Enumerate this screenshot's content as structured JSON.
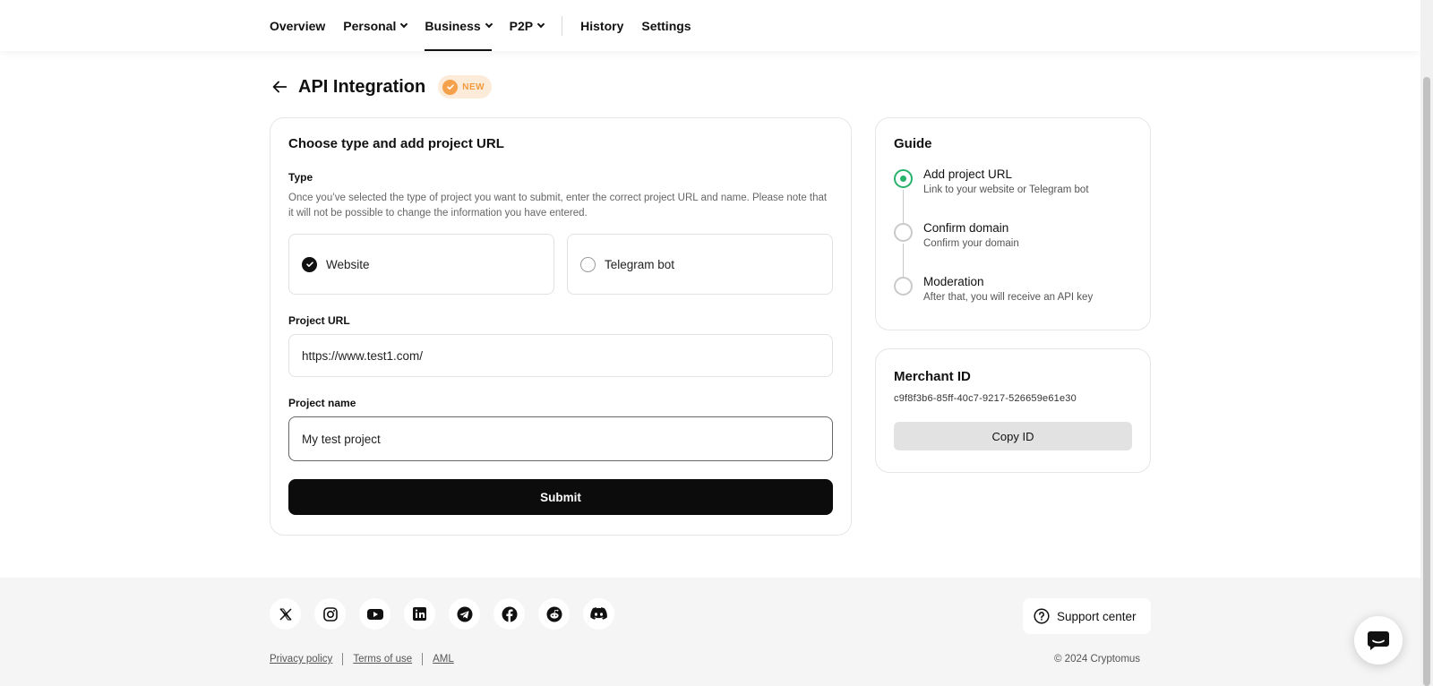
{
  "nav": {
    "items": [
      {
        "label": "Overview",
        "dropdown": false,
        "active": false
      },
      {
        "label": "Personal",
        "dropdown": true,
        "active": false
      },
      {
        "label": "Business",
        "dropdown": true,
        "active": true
      },
      {
        "label": "P2P",
        "dropdown": true,
        "active": false
      }
    ],
    "secondary": [
      {
        "label": "History"
      },
      {
        "label": "Settings"
      }
    ]
  },
  "header": {
    "title": "API Integration",
    "badge": "NEW"
  },
  "form": {
    "title": "Choose type and add project URL",
    "type_label": "Type",
    "type_description": "Once you’ve selected the type of project you want to submit, enter the correct project URL and name. Please note that it will not be possible to change the information you have entered.",
    "types": [
      {
        "label": "Website",
        "selected": true
      },
      {
        "label": "Telegram bot",
        "selected": false
      }
    ],
    "url_label": "Project URL",
    "url_value": "https://www.test1.com/",
    "name_label": "Project name",
    "name_value": "My test project",
    "submit_label": "Submit"
  },
  "guide": {
    "title": "Guide",
    "steps": [
      {
        "title": "Add project URL",
        "subtitle": "Link to your website or Telegram bot",
        "active": true
      },
      {
        "title": "Confirm domain",
        "subtitle": "Confirm your domain",
        "active": false
      },
      {
        "title": "Moderation",
        "subtitle": "After that, you will receive an API key",
        "active": false
      }
    ]
  },
  "merchant": {
    "title": "Merchant ID",
    "id": "c9f8f3b6-85ff-40c7-9217-526659e61e30",
    "copy_label": "Copy ID"
  },
  "footer": {
    "socials": [
      "x-icon",
      "instagram-icon",
      "youtube-icon",
      "linkedin-icon",
      "telegram-icon",
      "facebook-icon",
      "reddit-icon",
      "discord-icon"
    ],
    "links": [
      "Privacy policy",
      "Terms of use",
      "AML"
    ],
    "support_label": "Support center",
    "copyright": "© 2024 Cryptomus"
  },
  "colors": {
    "accent_green": "#27b36b",
    "badge_orange": "#f29a3f",
    "primary_button": "#0c0c0c"
  }
}
